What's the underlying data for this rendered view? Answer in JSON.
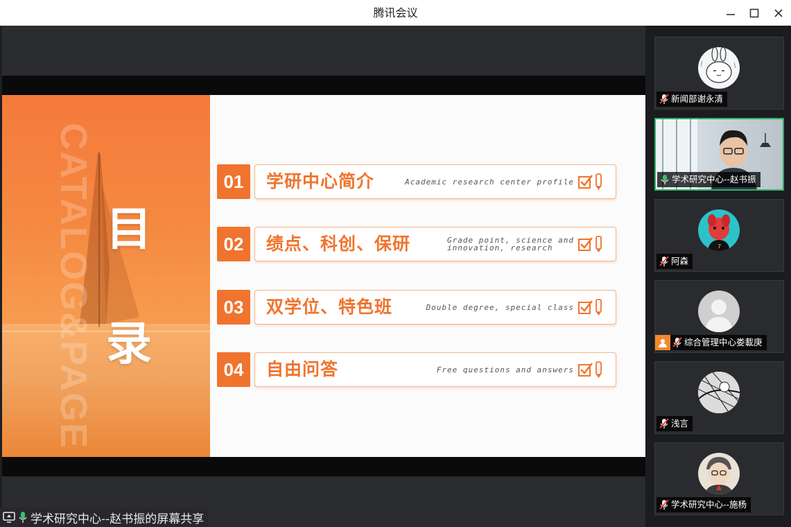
{
  "window": {
    "title": "腾讯会议"
  },
  "slide": {
    "side_watermark": "CATALOG&PAGE",
    "heading_chars": [
      "目",
      "录"
    ],
    "items": [
      {
        "num": "01",
        "title": "学研中心简介",
        "subtitle": [
          "Academic research center profile"
        ]
      },
      {
        "num": "02",
        "title": "绩点、科创、保研",
        "subtitle": [
          "Grade point, science and",
          "innovation, research"
        ]
      },
      {
        "num": "03",
        "title": "双学位、特色班",
        "subtitle": [
          "Double degree, special class"
        ]
      },
      {
        "num": "04",
        "title": "自由问答",
        "subtitle": [
          "Free questions and answers"
        ]
      }
    ]
  },
  "participants": [
    {
      "name": "新闻部谢永清",
      "mic": "muted",
      "avatar": "rabbit-doodle",
      "active": false
    },
    {
      "name": "学术研究中心--赵书振",
      "mic": "on",
      "avatar": "video-man-glasses",
      "active": true
    },
    {
      "name": "阿森",
      "mic": "muted",
      "avatar": "red-dog-cyan",
      "active": false
    },
    {
      "name": "综合管理中心娄載庚",
      "mic": "muted",
      "avatar": "default-gray",
      "active": false,
      "host_badge": true
    },
    {
      "name": "浅言",
      "mic": "muted",
      "avatar": "bw-sketch",
      "active": false
    },
    {
      "name": "学术研究中心--施杨",
      "mic": "muted",
      "avatar": "cartoon-boy",
      "active": false
    }
  ],
  "share_status": "学术研究中心--赵书振的屏幕共享",
  "colors": {
    "accent": "#f0742e",
    "active_border": "#2fb06a",
    "mute_red": "#ff4040"
  }
}
